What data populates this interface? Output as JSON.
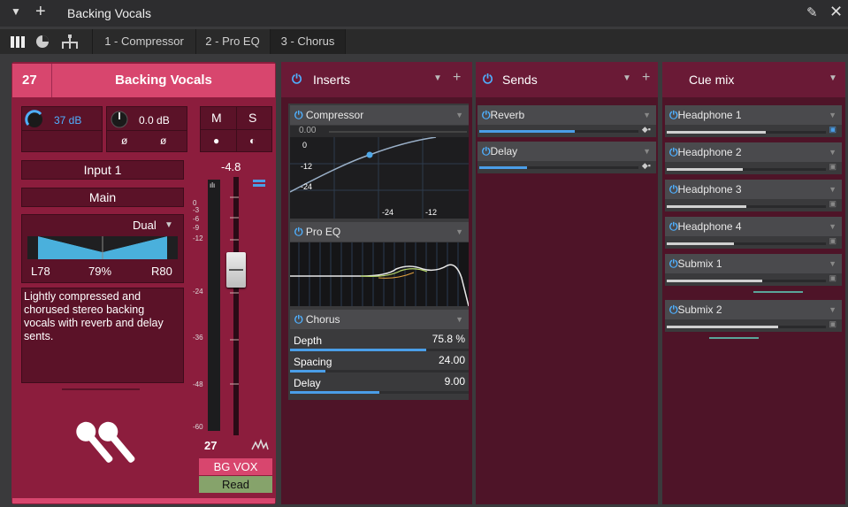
{
  "window": {
    "title": "Backing Vocals"
  },
  "tabs": [
    {
      "label": "1 - Compressor"
    },
    {
      "label": "2 - Pro EQ"
    },
    {
      "label": "3 - Chorus"
    }
  ],
  "strip": {
    "number": "27",
    "name": "Backing Vocals",
    "input_gain": "37 dB",
    "pan_knob": "0.0 dB",
    "phase_left": "ø",
    "phase_right": "ø",
    "mute": "M",
    "solo": "S",
    "record": "●",
    "monitor": "◐",
    "input": "Input 1",
    "output": "Main",
    "pan_mode": "Dual",
    "pan_left": "L78",
    "pan_width": "79%",
    "pan_right": "R80",
    "notes": "Lightly compressed and chorused stereo backing vocals with reverb and delay sents.",
    "fader_value": "-4.8",
    "meter_scale": [
      "0",
      "-3",
      "-6",
      "-9",
      "-12",
      "-24",
      "-36",
      "-48",
      "-60"
    ],
    "channel_number": "27",
    "label": "BG VOX",
    "automation": "Read",
    "volume_level": 0.62
  },
  "inserts": {
    "title": "Inserts",
    "compressor": {
      "name": "Compressor",
      "value": "0.00",
      "graph_labels_y": [
        "0",
        "-12",
        "-24"
      ],
      "graph_labels_x": [
        "-24",
        "-12"
      ]
    },
    "proeq": {
      "name": "Pro EQ"
    },
    "chorus": {
      "name": "Chorus",
      "params": [
        {
          "label": "Depth",
          "value": "75.8 %",
          "level": 0.76
        },
        {
          "label": "Spacing",
          "value": "24.00",
          "level": 0.2
        },
        {
          "label": "Delay",
          "value": "9.00",
          "level": 0.5
        }
      ]
    }
  },
  "sends": {
    "title": "Sends",
    "items": [
      {
        "label": "Reverb",
        "level": 0.6
      },
      {
        "label": "Delay",
        "level": 0.3
      }
    ]
  },
  "cuemix": {
    "title": "Cue mix",
    "items": [
      {
        "label": "Headphone 1",
        "level": 0.62
      },
      {
        "label": "Headphone 2",
        "level": 0.48
      },
      {
        "label": "Headphone 3",
        "level": 0.5
      },
      {
        "label": "Headphone 4",
        "level": 0.42
      },
      {
        "label": "Submix 1",
        "level": 0.6
      },
      {
        "label": "Submix 2",
        "level": 0.7
      }
    ]
  },
  "colors": {
    "accent": "#d8466e",
    "strip": "#8c1d3d",
    "panel": "#4e1428",
    "blue": "#4a9ee8"
  }
}
